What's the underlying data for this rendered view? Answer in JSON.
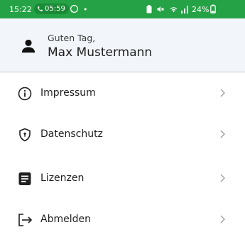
{
  "status_bar": {
    "time": "15:22",
    "call_time": "05:59",
    "dot": "•",
    "battery": "24%",
    "background_color": "#26a246",
    "icons": [
      "phone-icon",
      "whatsapp-icon",
      "battery-saver-icon",
      "mute-icon",
      "wifi-icon",
      "signal-icon",
      "battery-icon"
    ]
  },
  "greeting": {
    "hello": "Guten Tag,",
    "name": "Max Mustermann"
  },
  "menu": {
    "items": [
      {
        "label": "Impressum",
        "icon": "info-icon"
      },
      {
        "label": "Datenschutz",
        "icon": "shield-icon"
      },
      {
        "label": "Lizenzen",
        "icon": "document-icon"
      },
      {
        "label": "Abmelden",
        "icon": "logout-icon"
      }
    ]
  }
}
